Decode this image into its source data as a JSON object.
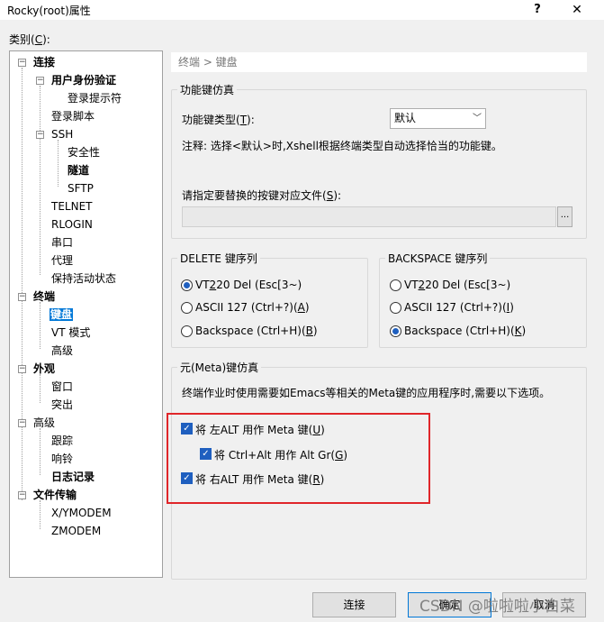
{
  "window": {
    "title": "Rocky(root)属性",
    "help": "?",
    "close": "✕"
  },
  "category_label": "类别(C):",
  "tree": [
    {
      "label": "连接"
    },
    {
      "label": "用户身份验证"
    },
    {
      "label": "登录提示符"
    },
    {
      "label": "登录脚本"
    },
    {
      "label": "SSH"
    },
    {
      "label": "安全性"
    },
    {
      "label": "隧道"
    },
    {
      "label": "SFTP"
    },
    {
      "label": "TELNET"
    },
    {
      "label": "RLOGIN"
    },
    {
      "label": "串口"
    },
    {
      "label": "代理"
    },
    {
      "label": "保持活动状态"
    },
    {
      "label": "终端"
    },
    {
      "label": "键盘"
    },
    {
      "label": "VT 模式"
    },
    {
      "label": "高级"
    },
    {
      "label": "外观"
    },
    {
      "label": "窗口"
    },
    {
      "label": "突出"
    },
    {
      "label": "高级"
    },
    {
      "label": "跟踪"
    },
    {
      "label": "响铃"
    },
    {
      "label": "日志记录"
    },
    {
      "label": "文件传输"
    },
    {
      "label": "X/YMODEM"
    },
    {
      "label": "ZMODEM"
    }
  ],
  "breadcrumb": "终端 > 键盘",
  "function_keys": {
    "title": "功能键仿真",
    "type_label": "功能键类型(T):",
    "type_value": "默认",
    "note": "注释: 选择<默认>时,Xshell根据终端类型自动选择恰当的功能键。",
    "file_label": "请指定要替换的按键对应文件(S):",
    "file_value": "",
    "browse": "..."
  },
  "delete_seq": {
    "title": "DELETE 键序列",
    "options": [
      "VT220 Del (Esc[3~)",
      "ASCII 127 (Ctrl+?)(A)",
      "Backspace (Ctrl+H)(B)"
    ],
    "selected": 0
  },
  "backspace_seq": {
    "title": "BACKSPACE 键序列",
    "options": [
      "VT220 Del (Esc[3~)",
      "ASCII 127 (Ctrl+?)(I)",
      "Backspace (Ctrl+H)(K)"
    ],
    "selected": 2
  },
  "meta": {
    "title": "元(Meta)键仿真",
    "desc": "终端作业时使用需要如Emacs等相关的Meta键的应用程序时,需要以下选项。",
    "left_alt": "将 左ALT 用作 Meta 键(U)",
    "ctrl_alt": "将 Ctrl+Alt 用作 Alt Gr(G)",
    "right_alt": "将 右ALT 用作 Meta 键(R)"
  },
  "buttons": {
    "connect": "连接",
    "ok": "确定",
    "cancel": "取消"
  },
  "watermark": "CSDN @啦啦啦小白菜"
}
